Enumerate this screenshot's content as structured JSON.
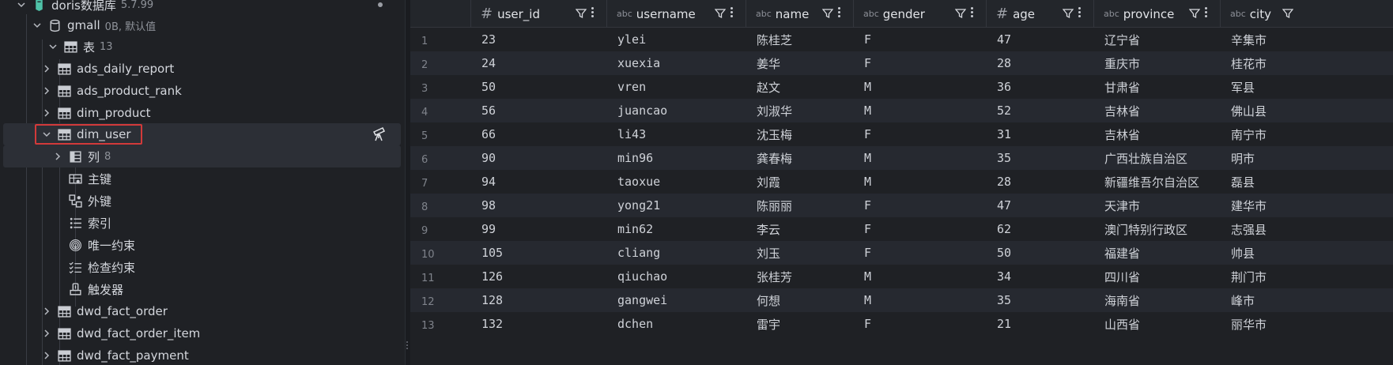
{
  "tree": {
    "nodes": [
      {
        "label": "doris数据库",
        "count": "5.7.99",
        "icon": "database-icon",
        "expanded": true
      },
      {
        "label": "gmall",
        "count": "0B, 默认值",
        "icon": "schema-icon",
        "expanded": true
      },
      {
        "label": "表",
        "count": "13",
        "icon": "tables-folder-icon",
        "expanded": true
      },
      {
        "label": "ads_daily_report",
        "icon": "table-icon"
      },
      {
        "label": "ads_product_rank",
        "icon": "table-icon"
      },
      {
        "label": "dim_product",
        "icon": "table-icon"
      },
      {
        "label": "dim_user",
        "icon": "table-icon",
        "expanded": true,
        "selected": true
      },
      {
        "label": "列",
        "count": "8",
        "icon": "columns-icon"
      },
      {
        "label": "主键",
        "icon": "primary-key-icon"
      },
      {
        "label": "外键",
        "icon": "foreign-key-icon"
      },
      {
        "label": "索引",
        "icon": "index-icon"
      },
      {
        "label": "唯一约束",
        "icon": "unique-constraint-icon"
      },
      {
        "label": "检查约束",
        "icon": "check-constraint-icon"
      },
      {
        "label": "触发器",
        "icon": "trigger-icon"
      },
      {
        "label": "dwd_fact_order",
        "icon": "table-icon"
      },
      {
        "label": "dwd_fact_order_item",
        "icon": "table-icon"
      },
      {
        "label": "dwd_fact_payment",
        "icon": "table-icon"
      }
    ]
  },
  "grid": {
    "columns": [
      {
        "type": "#",
        "name": "user_id"
      },
      {
        "type": "abc",
        "name": "username"
      },
      {
        "type": "abc",
        "name": "name"
      },
      {
        "type": "abc",
        "name": "gender"
      },
      {
        "type": "#",
        "name": "age"
      },
      {
        "type": "abc",
        "name": "province"
      },
      {
        "type": "abc",
        "name": "city"
      }
    ],
    "rows": [
      [
        "1",
        "23",
        "ylei",
        "陈桂芝",
        "F",
        "47",
        "辽宁省",
        "辛集市"
      ],
      [
        "2",
        "24",
        "xuexia",
        "姜华",
        "F",
        "28",
        "重庆市",
        "桂花市"
      ],
      [
        "3",
        "50",
        "vren",
        "赵文",
        "M",
        "36",
        "甘肃省",
        "军县"
      ],
      [
        "4",
        "56",
        "juancao",
        "刘淑华",
        "M",
        "52",
        "吉林省",
        "佛山县"
      ],
      [
        "5",
        "66",
        "li43",
        "沈玉梅",
        "F",
        "31",
        "吉林省",
        "南宁市"
      ],
      [
        "6",
        "90",
        "min96",
        "龚春梅",
        "M",
        "35",
        "广西壮族自治区",
        "明市"
      ],
      [
        "7",
        "94",
        "taoxue",
        "刘霞",
        "M",
        "28",
        "新疆维吾尔自治区",
        "磊县"
      ],
      [
        "8",
        "98",
        "yong21",
        "陈丽丽",
        "F",
        "47",
        "天津市",
        "建华市"
      ],
      [
        "9",
        "99",
        "min62",
        "李云",
        "F",
        "62",
        "澳门特别行政区",
        "志强县"
      ],
      [
        "10",
        "105",
        "cliang",
        "刘玉",
        "F",
        "50",
        "福建省",
        "帅县"
      ],
      [
        "11",
        "126",
        "qiuchao",
        "张桂芳",
        "M",
        "34",
        "四川省",
        "荆门市"
      ],
      [
        "12",
        "128",
        "gangwei",
        "何想",
        "M",
        "35",
        "海南省",
        "峰市"
      ],
      [
        "13",
        "132",
        "dchen",
        "雷宇",
        "F",
        "21",
        "山西省",
        "丽华市"
      ]
    ]
  }
}
